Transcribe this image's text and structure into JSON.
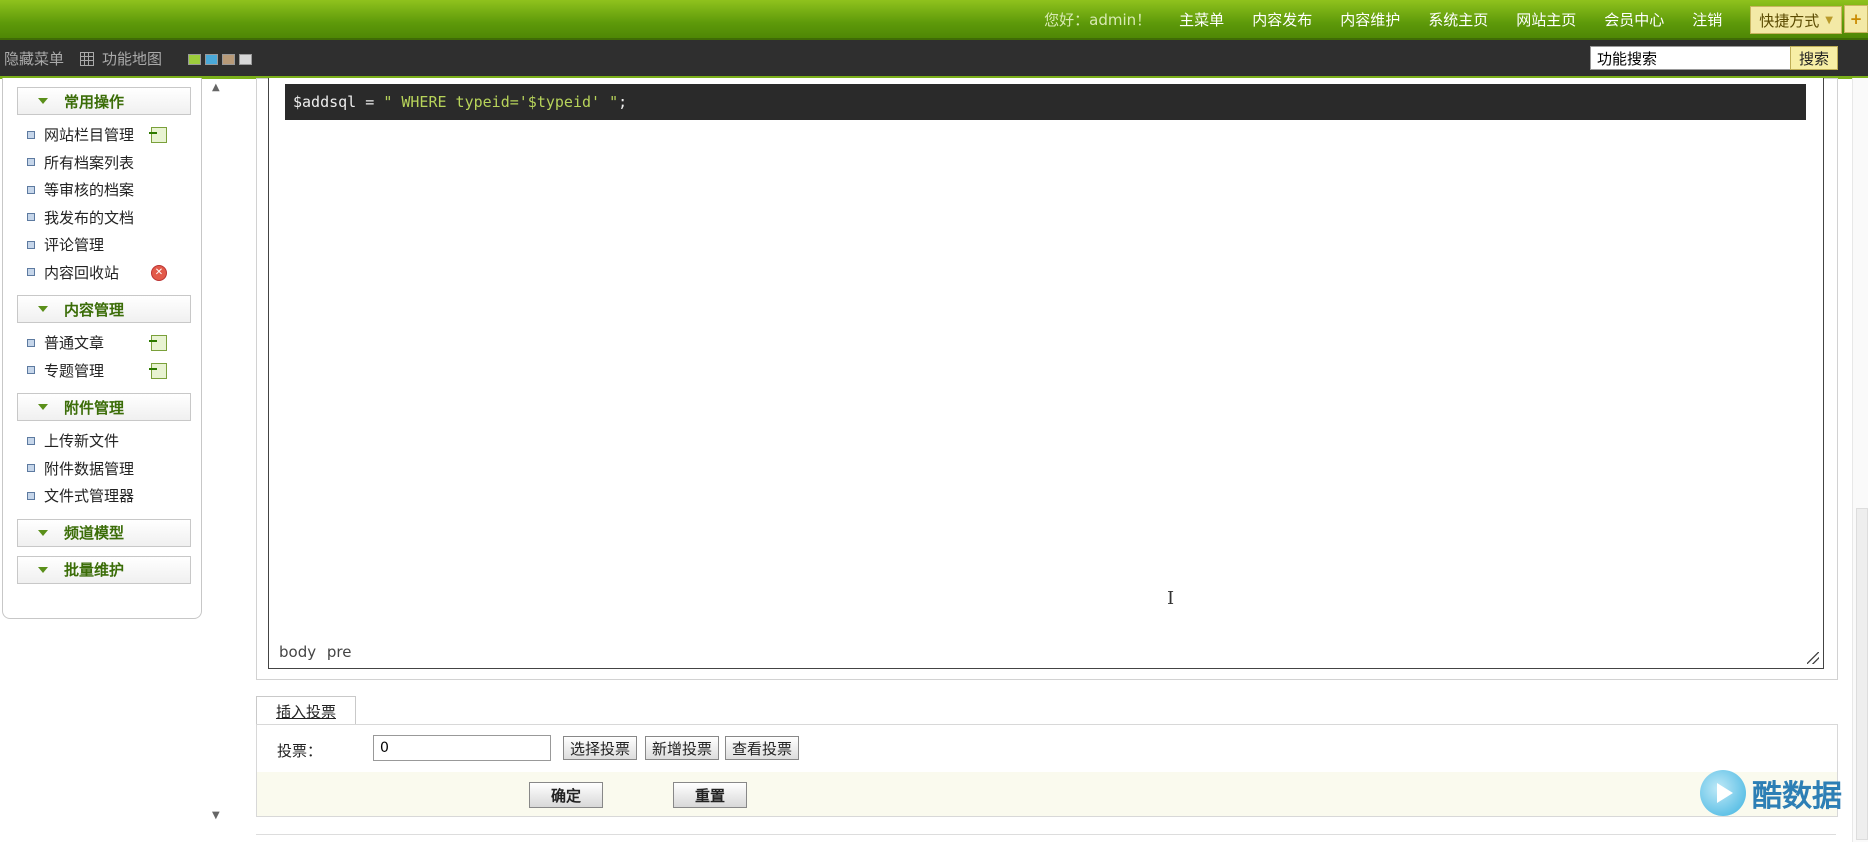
{
  "topnav": {
    "greeting": "您好：admin！",
    "links": [
      "主菜单",
      "内容发布",
      "内容维护",
      "系统主页",
      "网站主页",
      "会员中心",
      "注销"
    ],
    "quick_label": "快捷方式",
    "plus": "+"
  },
  "subbar": {
    "hide_menu": "隐藏菜单",
    "sitemap": "功能地图",
    "skin_colors": [
      "#9ccc3c",
      "#4aa8d8",
      "#b89a78",
      "#d8d8d8"
    ],
    "search_value": "功能搜索",
    "search_button": "搜索"
  },
  "sidebar": {
    "groups": [
      {
        "title": "常用操作",
        "items": [
          "网站栏目管理",
          "所有档案列表",
          "等审核的档案",
          "我发布的文档",
          "评论管理",
          "内容回收站"
        ]
      },
      {
        "title": "内容管理",
        "items": [
          "普通文章",
          "专题管理"
        ]
      },
      {
        "title": "附件管理",
        "items": [
          "上传新文件",
          "附件数据管理",
          "文件式管理器"
        ]
      },
      {
        "title": "频道模型",
        "items": []
      },
      {
        "title": "批量维护",
        "items": []
      }
    ]
  },
  "editor": {
    "code_prefix": "$addsql = ",
    "code_string": "\" WHERE typeid='$typeid' \"",
    "code_suffix": ";",
    "path": "body pre"
  },
  "vote": {
    "tab_label": "插入投票",
    "label": "投票：",
    "input_value": "0",
    "select_button": "选择投票",
    "add_button": "新增投票",
    "view_button": "查看投票"
  },
  "actions": {
    "confirm": "确定",
    "reset": "重置"
  },
  "watermark": {
    "text": "酷数据"
  }
}
